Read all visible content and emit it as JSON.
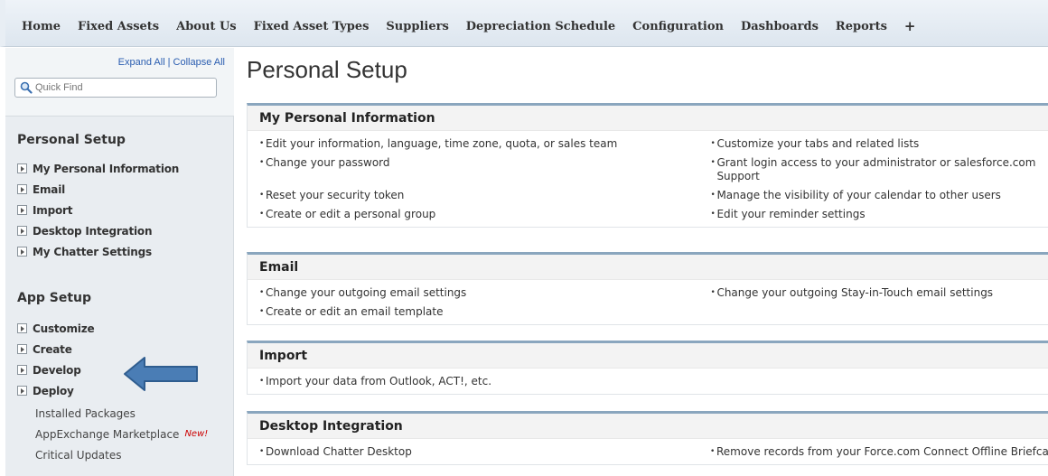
{
  "nav": {
    "tabs": [
      "Home",
      "Fixed Assets",
      "About Us",
      "Fixed Asset Types",
      "Suppliers",
      "Depreciation Schedule",
      "Configuration",
      "Dashboards",
      "Reports",
      "+"
    ]
  },
  "sidebar": {
    "expand_all": "Expand All",
    "separator": "|",
    "collapse_all": "Collapse All",
    "quick_find_placeholder": "Quick Find",
    "personal_setup": {
      "title": "Personal Setup",
      "items": [
        "My Personal Information",
        "Email",
        "Import",
        "Desktop Integration",
        "My Chatter Settings"
      ]
    },
    "app_setup": {
      "title": "App Setup",
      "items": [
        "Customize",
        "Create",
        "Develop",
        "Deploy"
      ],
      "plain_items": [
        "Installed Packages",
        "AppExchange Marketplace",
        "Critical Updates"
      ],
      "new_badge": "New!"
    }
  },
  "main": {
    "title": "Personal Setup",
    "panels": [
      {
        "title": "My Personal Information",
        "rows": [
          [
            "Edit your information, language, time zone, quota, or sales team",
            "Customize your tabs and related lists"
          ],
          [
            "Change your password",
            "Grant login access to your administrator or salesforce.com Support"
          ],
          [
            "Reset your security token",
            "Manage the visibility of your calendar to other users"
          ],
          [
            "Create or edit a personal group",
            "Edit your reminder settings"
          ]
        ]
      },
      {
        "title": "Email",
        "rows": [
          [
            "Change your outgoing email settings",
            "Change your outgoing Stay-in-Touch email settings"
          ],
          [
            "Create or edit an email template",
            ""
          ]
        ]
      },
      {
        "title": "Import",
        "rows": [
          [
            "Import your data from Outlook, ACT!, etc.",
            ""
          ]
        ]
      },
      {
        "title": "Desktop Integration",
        "rows": [
          [
            "Download Chatter Desktop",
            "Remove records from your Force.com Connect Offline Briefcase"
          ]
        ]
      }
    ]
  },
  "colors": {
    "link": "#2a5db0",
    "panel_border": "#8aa6be",
    "arrow": "#4a7db5",
    "badge": "#cc0000"
  }
}
